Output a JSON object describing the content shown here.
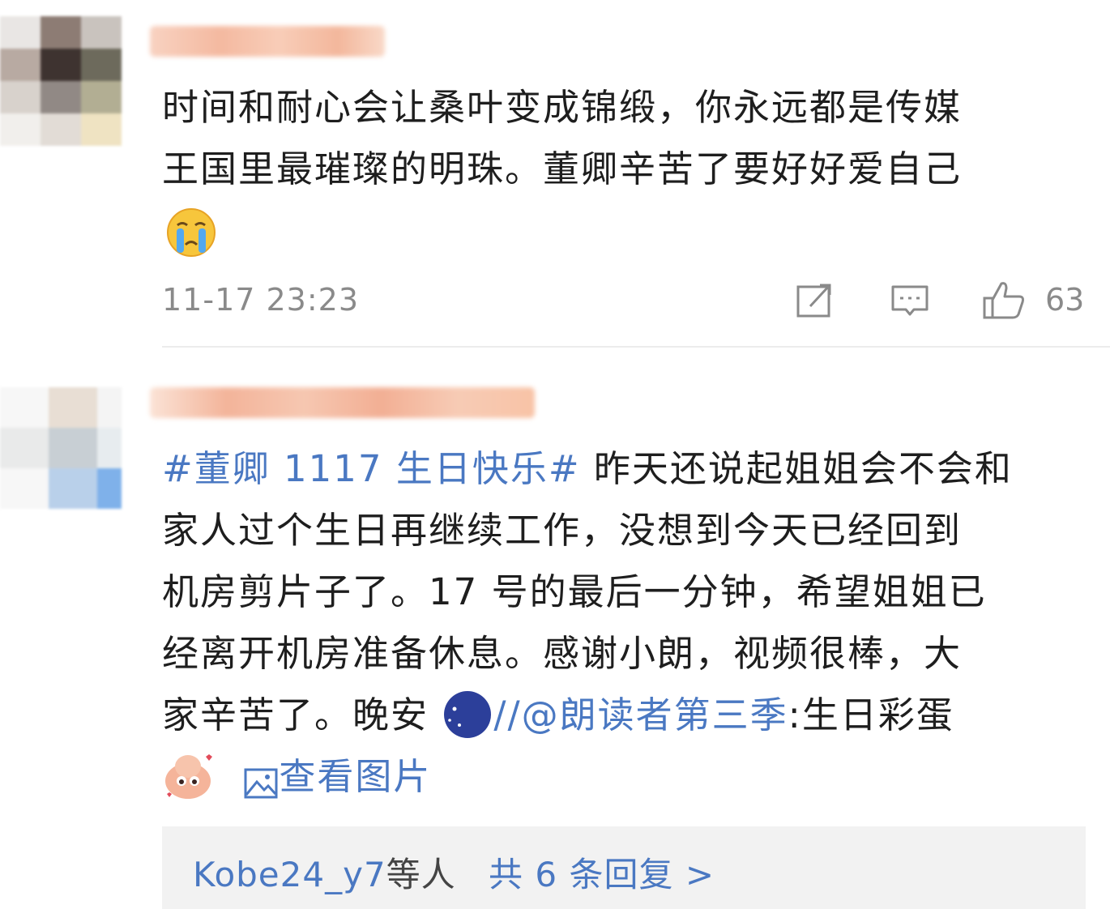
{
  "comments": [
    {
      "text_line1": "时间和耐心会让桑叶变成锦缎，你永远都是传媒",
      "text_line2": "王国里最璀璨的明珠。董卿辛苦了要好好爱自己",
      "emoji": "crying-face-icon",
      "time": "11-17 23:23",
      "like_count": "63"
    },
    {
      "hashtag": "#董卿 1117 生日快乐#",
      "line1_rest": " 昨天还说起姐姐会不会和",
      "line2": "家人过个生日再继续工作，没想到今天已经回到",
      "line3": "机房剪片子了。17 号的最后一分钟，希望姐姐已",
      "line4": "经离开机房准备休息。感谢小朗，视频很棒，大",
      "line5_pre": "家辛苦了。晚安 ",
      "line5_sep": "//",
      "mention": "@朗读者第三季",
      "line5_post": ":生日彩蛋",
      "view_image": "查看图片",
      "reply_users": "Kobe24_y7",
      "reply_users_suffix": "等人",
      "reply_total": "共 6 条回复 >"
    }
  ],
  "colors": {
    "link": "#4a78c2",
    "meta": "#8a8a8a",
    "reply_bg": "#f2f2f2"
  }
}
